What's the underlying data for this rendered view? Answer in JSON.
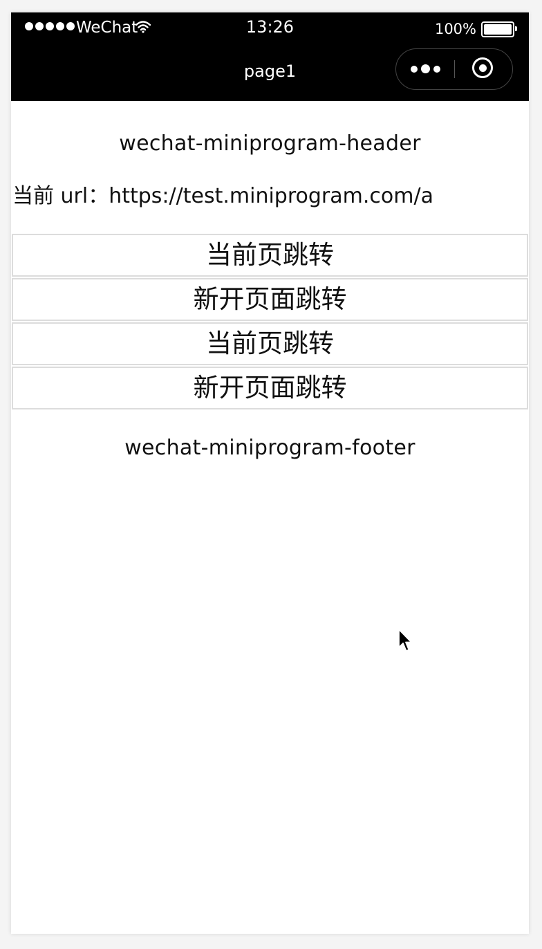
{
  "status_bar": {
    "carrier": "WeChat",
    "time": "13:26",
    "battery_percent": "100%",
    "battery_level": 1.0,
    "signal_dots": 5
  },
  "nav": {
    "title": "page1"
  },
  "content": {
    "header": "wechat-miniprogram-header",
    "url_label": "当前 url：",
    "url_value": "https://test.miniprogram.com/a",
    "buttons": [
      {
        "label": "当前页跳转"
      },
      {
        "label": "新开页面跳转"
      },
      {
        "label": "当前页跳转"
      },
      {
        "label": "新开页面跳转"
      }
    ],
    "footer": "wechat-miniprogram-footer"
  },
  "icons": {
    "wifi": "wifi-icon",
    "battery": "battery-icon",
    "more": "more-dots-icon",
    "close": "close-miniprogram-icon",
    "cursor": "mouse-cursor-icon"
  },
  "colors": {
    "nav_background": "#000000",
    "nav_text": "#ffffff",
    "page_background": "#ffffff",
    "button_border": "#dcdcdc",
    "text": "#111111"
  }
}
